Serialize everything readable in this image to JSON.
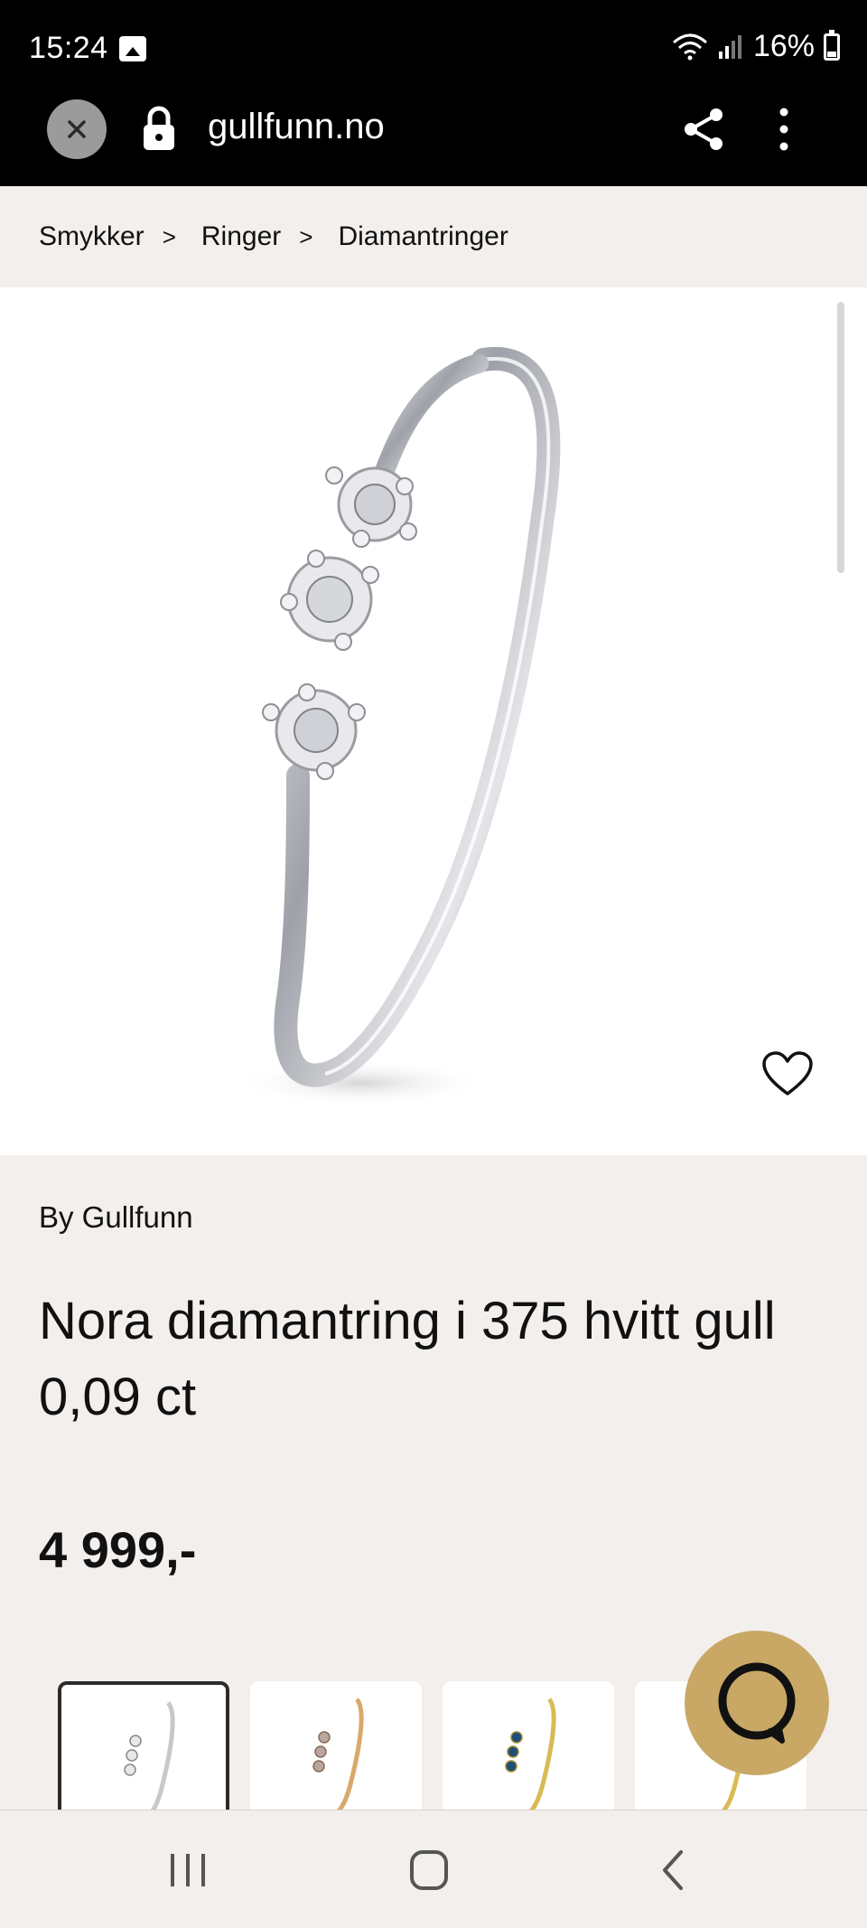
{
  "status_bar": {
    "time": "15:24",
    "battery_percent": "16%"
  },
  "browser": {
    "url": "gullfunn.no"
  },
  "breadcrumb": {
    "items": [
      "Smykker",
      "Ringer",
      "Diamantringer"
    ],
    "separator": ">"
  },
  "product": {
    "brand": "By Gullfunn",
    "title": "Nora diamantring i 375 hvitt gull 0,09 ct",
    "price": "4 999,-"
  },
  "thumbnails": [
    {
      "name": "white-gold-variant",
      "metal_color": "#c8c8c8",
      "stone_color": "#e8e8e8",
      "selected": true
    },
    {
      "name": "rose-gold-variant",
      "metal_color": "#d9a86b",
      "stone_color": "#b8a6a0",
      "selected": false
    },
    {
      "name": "sapphire-variant",
      "metal_color": "#d8bb55",
      "stone_color": "#1f4f78",
      "selected": false
    },
    {
      "name": "pink-stone-variant",
      "metal_color": "#d8bb55",
      "stone_color": "#b0205e",
      "selected": false
    }
  ],
  "colors": {
    "accent": "#c9a866",
    "background": "#f2efed",
    "text": "#111111"
  },
  "icons": {
    "close": "close-icon",
    "lock": "lock-icon",
    "share": "share-icon",
    "menu": "more-vertical-icon",
    "wishlist": "heart-icon",
    "chat": "chat-bubble-icon",
    "nav_recents": "recents-icon",
    "nav_home": "home-icon",
    "nav_back": "back-icon"
  }
}
